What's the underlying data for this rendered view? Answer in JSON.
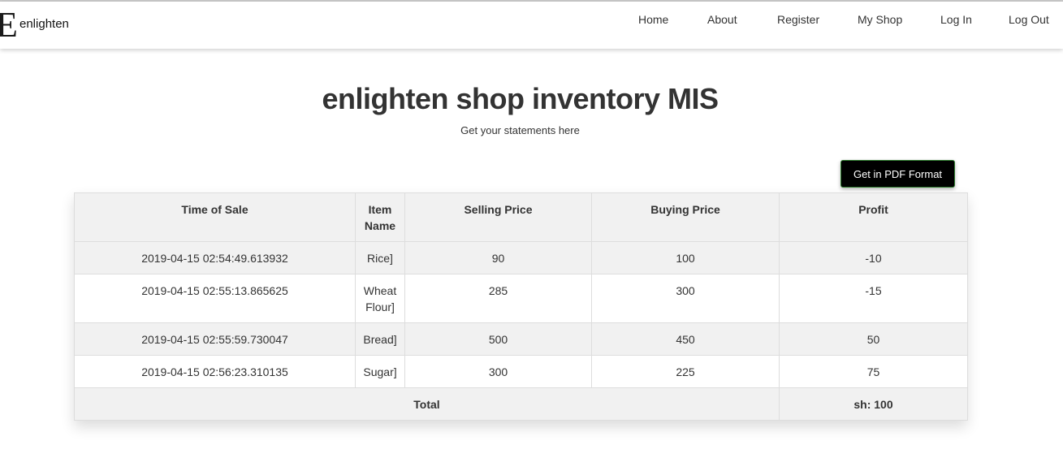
{
  "brand": {
    "logo_glyph": "E",
    "name": "enlighten"
  },
  "nav": {
    "home": "Home",
    "about": "About",
    "register": "Register",
    "my_shop": "My Shop",
    "log_in": "Log In",
    "log_out": "Log Out"
  },
  "header": {
    "title": "enlighten shop inventory MIS",
    "subtitle": "Get your statements here"
  },
  "actions": {
    "pdf_label": "Get in PDF Format"
  },
  "table": {
    "columns": [
      "Time of Sale",
      "Item Name",
      "Selling Price",
      "Buying Price",
      "Profit"
    ],
    "rows": [
      {
        "time": "2019-04-15 02:54:49.613932",
        "item": "Rice]",
        "selling": "90",
        "buying": "100",
        "profit": "-10"
      },
      {
        "time": "2019-04-15 02:55:13.865625",
        "item": "Wheat Flour]",
        "selling": "285",
        "buying": "300",
        "profit": "-15"
      },
      {
        "time": "2019-04-15 02:55:59.730047",
        "item": "Bread]",
        "selling": "500",
        "buying": "450",
        "profit": "50"
      },
      {
        "time": "2019-04-15 02:56:23.310135",
        "item": "Sugar]",
        "selling": "300",
        "buying": "225",
        "profit": "75"
      }
    ],
    "total_label": "Total",
    "total_value": "sh: 100"
  },
  "colors": {
    "nav_bg": "#ffffff",
    "row_alt": "#f1f1f1",
    "button_bg": "#000000",
    "button_border": "#2d7a2d",
    "text": "#333333"
  }
}
